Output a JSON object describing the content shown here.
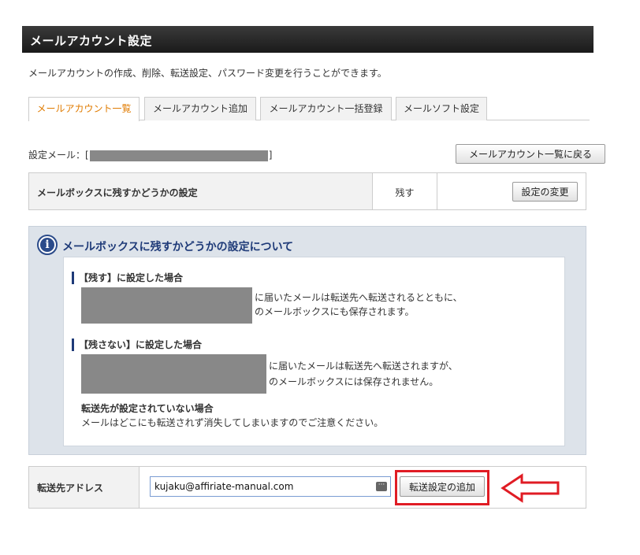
{
  "header": {
    "title": "メールアカウント設定"
  },
  "description": "メールアカウントの作成、削除、転送設定、パスワード変更を行うことができます。",
  "tabs": [
    {
      "label": "メールアカウント一覧",
      "active": true
    },
    {
      "label": "メールアカウント追加",
      "active": false
    },
    {
      "label": "メールアカウント一括登録",
      "active": false
    },
    {
      "label": "メールソフト設定",
      "active": false
    }
  ],
  "setting_mail": {
    "prefix": "設定メール：[",
    "suffix": "]"
  },
  "back_button_label": "メールアカウント一覧に戻る",
  "mailbox_setting": {
    "label": "メールボックスに残すかどうかの設定",
    "value": "残す",
    "change_button_label": "設定の変更"
  },
  "info": {
    "title": "メールボックスに残すかどうかの設定について",
    "keep": {
      "heading": "【残す】に設定した場合",
      "line1": "に届いたメールは転送先へ転送されるとともに、",
      "line2": "のメールボックスにも保存されます。"
    },
    "no_keep": {
      "heading": "【残さない】に設定した場合",
      "line1": "に届いたメールは転送先へ転送されますが、",
      "line2": "のメールボックスには保存されません。"
    },
    "note_heading": "転送先が設定されていない場合",
    "note_text": "メールはどこにも転送されず消失してしまいますのでご注意ください。"
  },
  "forward": {
    "label": "転送先アドレス",
    "input_value": "kujaku@affiriate-manual.com",
    "add_button_label": "転送設定の追加"
  },
  "colors": {
    "accent_tab": "#e07b00",
    "highlight": "#e01c24",
    "header_bg": "#222222",
    "info_title": "#1e3a78"
  }
}
